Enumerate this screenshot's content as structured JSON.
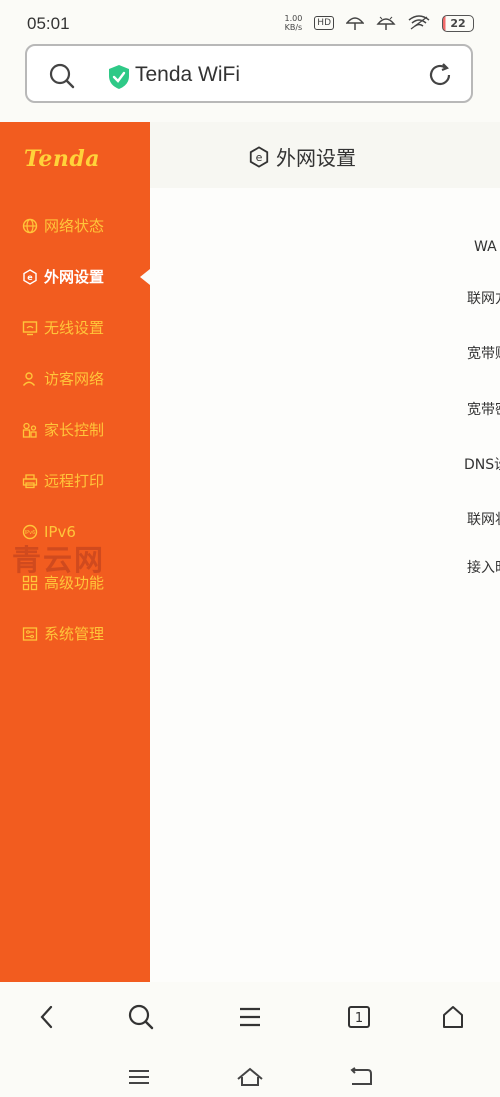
{
  "status": {
    "time": "05:01",
    "speed_value": "1.00",
    "speed_unit": "KB/s",
    "hd": "HD",
    "battery": "22"
  },
  "url": {
    "text": "Tenda WiFi"
  },
  "sidebar": {
    "logo": "Tenda",
    "items": [
      {
        "label": "网络状态",
        "icon": "globe-icon"
      },
      {
        "label": "外网设置",
        "icon": "wan-icon"
      },
      {
        "label": "无线设置",
        "icon": "wifi-screen-icon"
      },
      {
        "label": "访客网络",
        "icon": "guest-icon"
      },
      {
        "label": "家长控制",
        "icon": "parental-icon"
      },
      {
        "label": "远程打印",
        "icon": "printer-icon"
      },
      {
        "label": "IPv6",
        "icon": "ipv6-icon"
      },
      {
        "label": "高级功能",
        "icon": "advanced-icon"
      },
      {
        "label": "系统管理",
        "icon": "settings-icon"
      }
    ],
    "active_index": 1,
    "watermark": "青云网"
  },
  "main": {
    "title": "外网设置",
    "labels": [
      "WA",
      "联网方",
      "宽带账",
      "宽带密",
      "DNS设",
      "联网状",
      "接入时"
    ]
  },
  "colors": {
    "sidebar": "#f25c1f",
    "menu_text": "#ffc53a",
    "active_text": "#ffffff",
    "logo": "#ffd33a"
  }
}
